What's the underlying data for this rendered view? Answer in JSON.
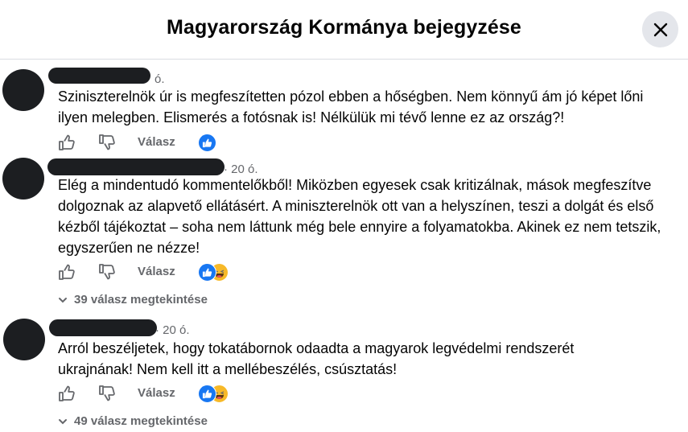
{
  "header": {
    "title": "Magyarország Kormánya bejegyzése",
    "close_icon": "close-icon"
  },
  "comments": [
    {
      "timestamp": "ó.",
      "text": "Sziniszterelnök úr is megfeszítetten pózol ebben a hőségben. Nem könnyű ám jó képet lőni ilyen melegben. Elismerés a fotósnak is! Nélkülük mi tévő lenne ez az ország?!",
      "like_label": "like-icon",
      "dislike_label": "dislike-icon",
      "reply_label": "Válasz",
      "reactions": [
        "like"
      ]
    },
    {
      "timestamp": "20 ó.",
      "text": "Elég a mindentudó kommentelőkből! Miközben egyesek csak kritizálnak, mások megfeszítve dolgoznak az alapvető ellátásért. A miniszterelnök ott van a helyszínen, teszi a dolgát és első kézből tájékoztat – soha nem láttunk még bele ennyire a folyamatokba. Akinek ez nem tetszik, egyszerűen ne nézze!",
      "reply_label": "Válasz",
      "reactions": [
        "like",
        "haha"
      ],
      "view_replies": "39 válasz megtekintése"
    },
    {
      "timestamp": "20 ó.",
      "text": "Arról beszéljetek, hogy tokatábornok odaadta a magyarok legvédelmi rendszerét ukrajnának! Nem kell itt a mellébeszélés, csúsztatás!",
      "reply_label": "Válasz",
      "reactions": [
        "like",
        "haha"
      ],
      "view_replies": "49 válasz megtekintése"
    }
  ],
  "colors": {
    "secondary_text": "#65676b",
    "like_blue": "#1877f2",
    "haha_yellow": "#f7b928",
    "redaction": "#1c1e21"
  }
}
